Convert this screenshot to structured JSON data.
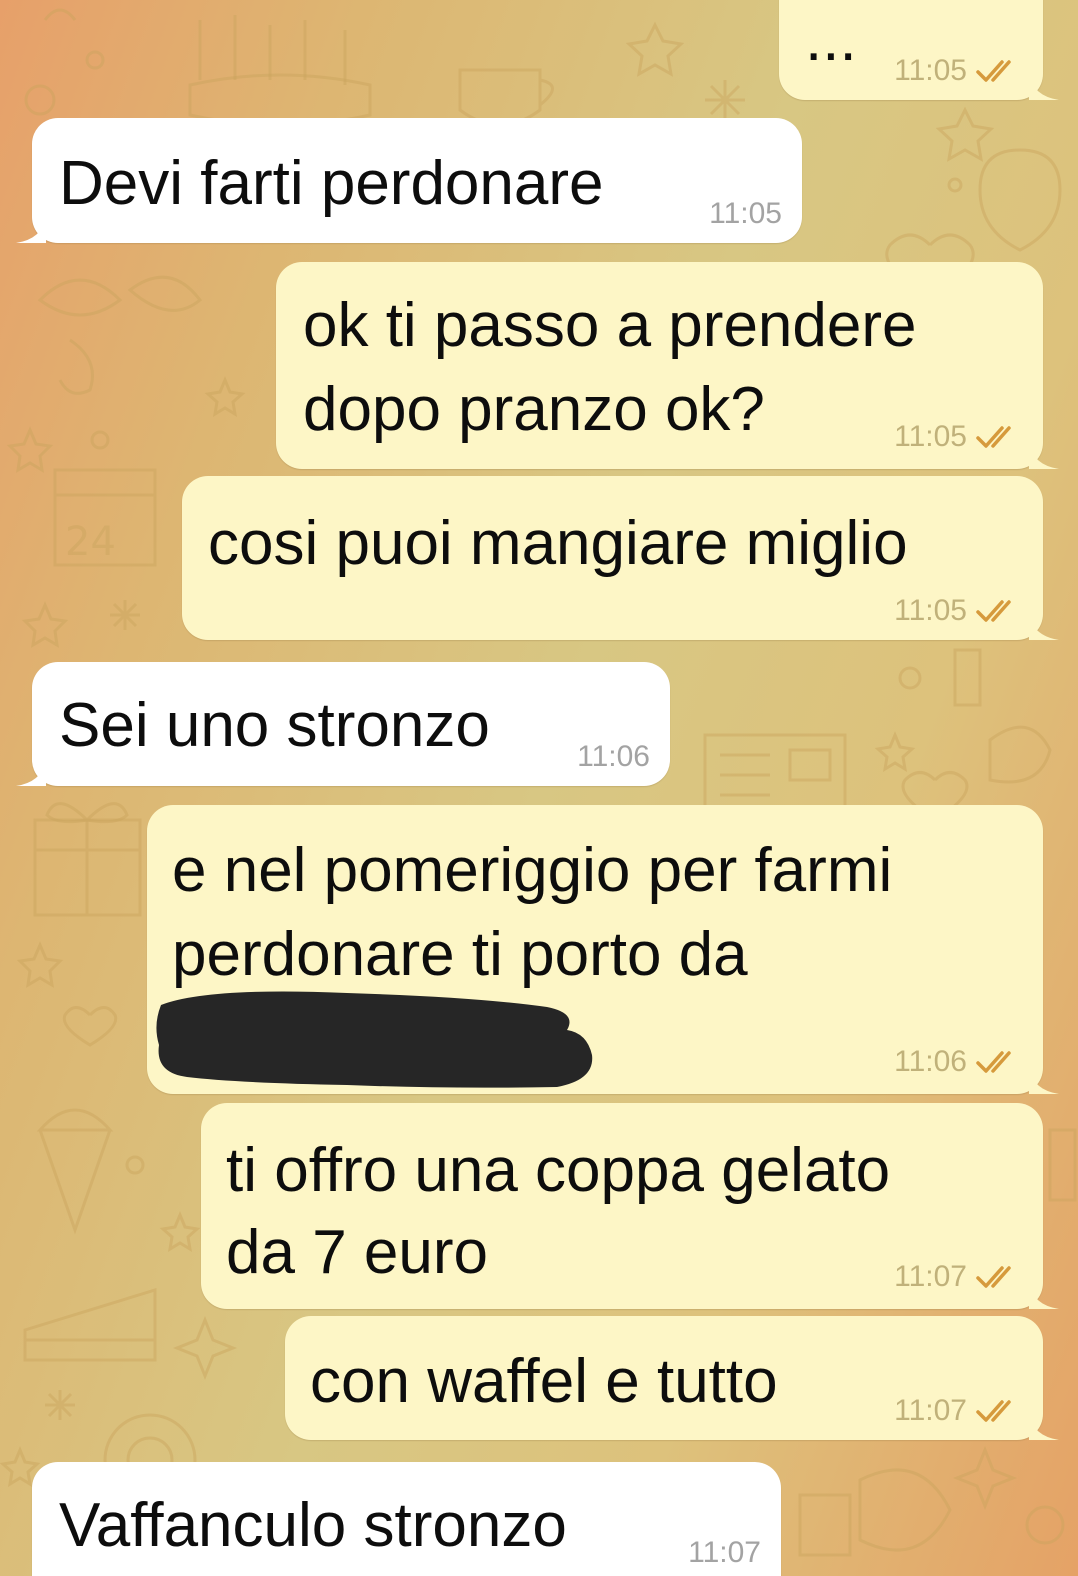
{
  "messages": [
    {
      "id": "m1",
      "direction": "out",
      "text": "...",
      "time": "11:05",
      "status": "read-check-icon"
    },
    {
      "id": "m2",
      "direction": "in",
      "text": "Devi farti perdonare",
      "time": "11:05"
    },
    {
      "id": "m3",
      "direction": "out",
      "lines": [
        "ok ti passo a prendere",
        "dopo pranzo ok?"
      ],
      "time": "11:05",
      "status": "read-check-icon"
    },
    {
      "id": "m4",
      "direction": "out",
      "text": "cosi puoi mangiare miglio",
      "time": "11:05",
      "status": "read-check-icon"
    },
    {
      "id": "m5",
      "direction": "in",
      "text": "Sei uno stronzo",
      "time": "11:06"
    },
    {
      "id": "m6",
      "direction": "out",
      "lines": [
        "e nel pomeriggio per farmi",
        "perdonare ti porto da"
      ],
      "redacted": true,
      "time": "11:06",
      "status": "read-check-icon"
    },
    {
      "id": "m7",
      "direction": "out",
      "lines": [
        "ti offro una coppa gelato",
        "da 7 euro"
      ],
      "time": "11:07",
      "status": "read-check-icon"
    },
    {
      "id": "m8",
      "direction": "out",
      "text": "con waffel e tutto",
      "time": "11:07",
      "status": "read-check-icon"
    },
    {
      "id": "m9",
      "direction": "in",
      "text": "Vaffanculo stronzo",
      "time": "11:07"
    }
  ],
  "theme": {
    "incoming_bubble": "#ffffff",
    "outgoing_bubble": "#fdf6c6",
    "check_color": "#d69a3c",
    "redaction_color": "#262626",
    "background_gradient": [
      "#e7a06a",
      "#d8c783",
      "#e5a266"
    ]
  }
}
